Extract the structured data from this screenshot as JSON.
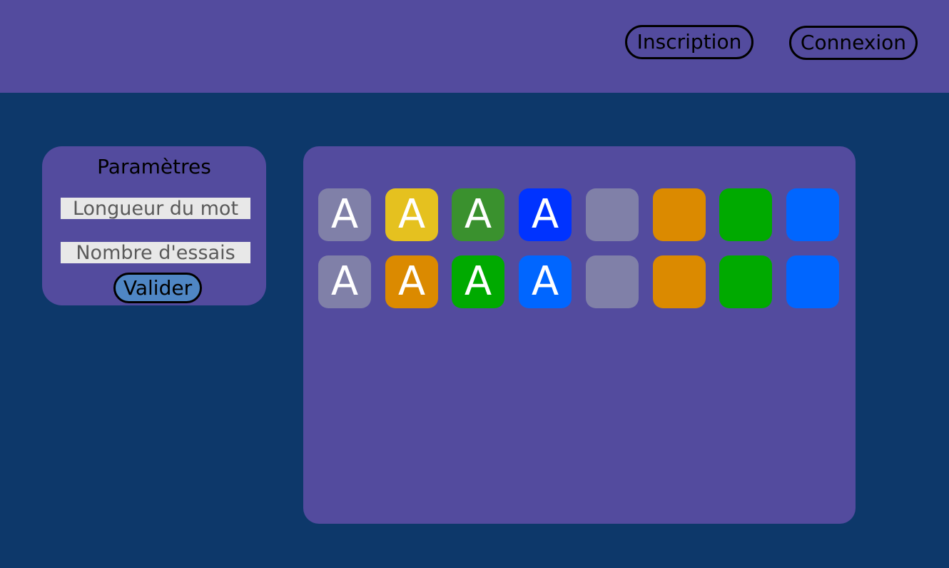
{
  "header": {
    "signup_label": "Inscription",
    "login_label": "Connexion"
  },
  "settings": {
    "title": "Paramètres",
    "word_length_placeholder": "Longueur du mot",
    "attempts_placeholder": "Nombre d'essais",
    "submit_label": "Valider"
  },
  "board": {
    "rows": [
      [
        {
          "letter": "A",
          "color": "#8080a8"
        },
        {
          "letter": "A",
          "color": "#e5c11f"
        },
        {
          "letter": "A",
          "color": "#3a912e"
        },
        {
          "letter": "A",
          "color": "#0033ff"
        },
        {
          "letter": "",
          "color": "#8080a8"
        },
        {
          "letter": "",
          "color": "#db8a00"
        },
        {
          "letter": "",
          "color": "#00aa00"
        },
        {
          "letter": "",
          "color": "#0066ff"
        }
      ],
      [
        {
          "letter": "A",
          "color": "#8080a8"
        },
        {
          "letter": "A",
          "color": "#db8a00"
        },
        {
          "letter": "A",
          "color": "#00aa00"
        },
        {
          "letter": "A",
          "color": "#0066ff"
        },
        {
          "letter": "",
          "color": "#8080a8"
        },
        {
          "letter": "",
          "color": "#db8a00"
        },
        {
          "letter": "",
          "color": "#00aa00"
        },
        {
          "letter": "",
          "color": "#0066ff"
        }
      ]
    ]
  },
  "colors": {
    "header_bg": "#534b9e",
    "page_bg": "#0d386a",
    "panel_bg": "#534b9e",
    "button_accent": "#4f86c4"
  }
}
